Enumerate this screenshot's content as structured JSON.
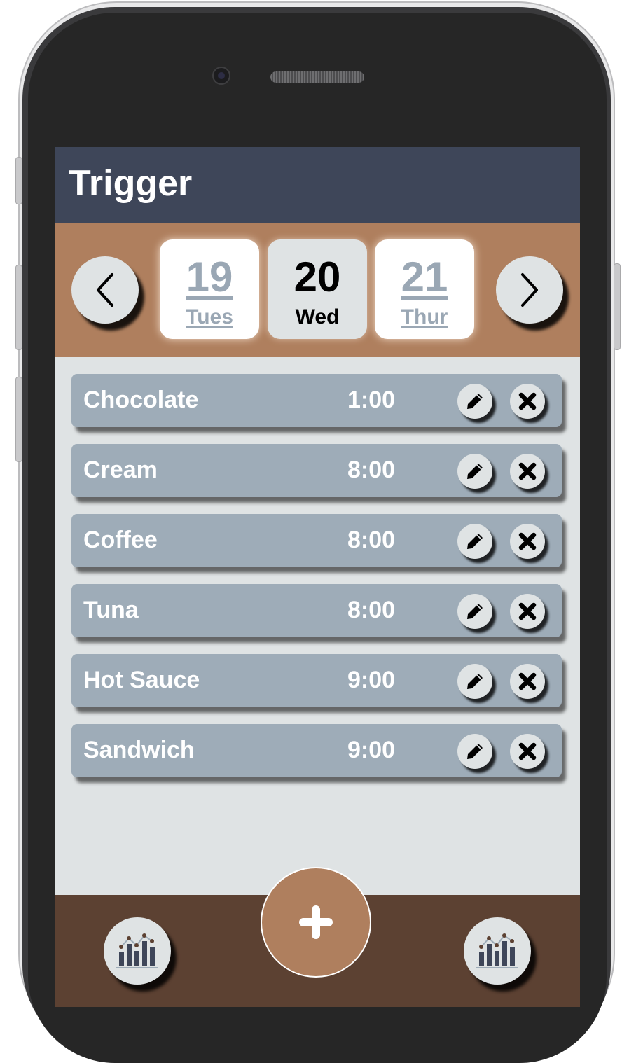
{
  "app": {
    "title": "Trigger"
  },
  "date_nav": {
    "prev_icon": "chevron-left-icon",
    "next_icon": "chevron-right-icon",
    "dates": [
      {
        "number": "19",
        "day": "Tues",
        "selected": false
      },
      {
        "number": "20",
        "day": "Wed",
        "selected": true
      },
      {
        "number": "21",
        "day": "Thur",
        "selected": false
      }
    ]
  },
  "triggers": [
    {
      "name": "Chocolate",
      "time": "1:00"
    },
    {
      "name": "Cream",
      "time": "8:00"
    },
    {
      "name": "Coffee",
      "time": "8:00"
    },
    {
      "name": "Tuna",
      "time": "8:00"
    },
    {
      "name": "Hot Sauce",
      "time": "9:00"
    },
    {
      "name": "Sandwich",
      "time": "9:00"
    }
  ],
  "row_actions": {
    "edit_icon": "pencil-icon",
    "delete_icon": "close-icon"
  },
  "bottom_bar": {
    "left_icon": "bar-chart-icon",
    "add_icon": "plus-icon",
    "right_icon": "bar-chart-icon"
  },
  "colors": {
    "header": "#3e4659",
    "date_bar": "#af7f5e",
    "row": "#9eacb8",
    "bottom_bar": "#5c4132",
    "accent": "#af7f5e",
    "screen_bg": "#dfe3e4"
  }
}
